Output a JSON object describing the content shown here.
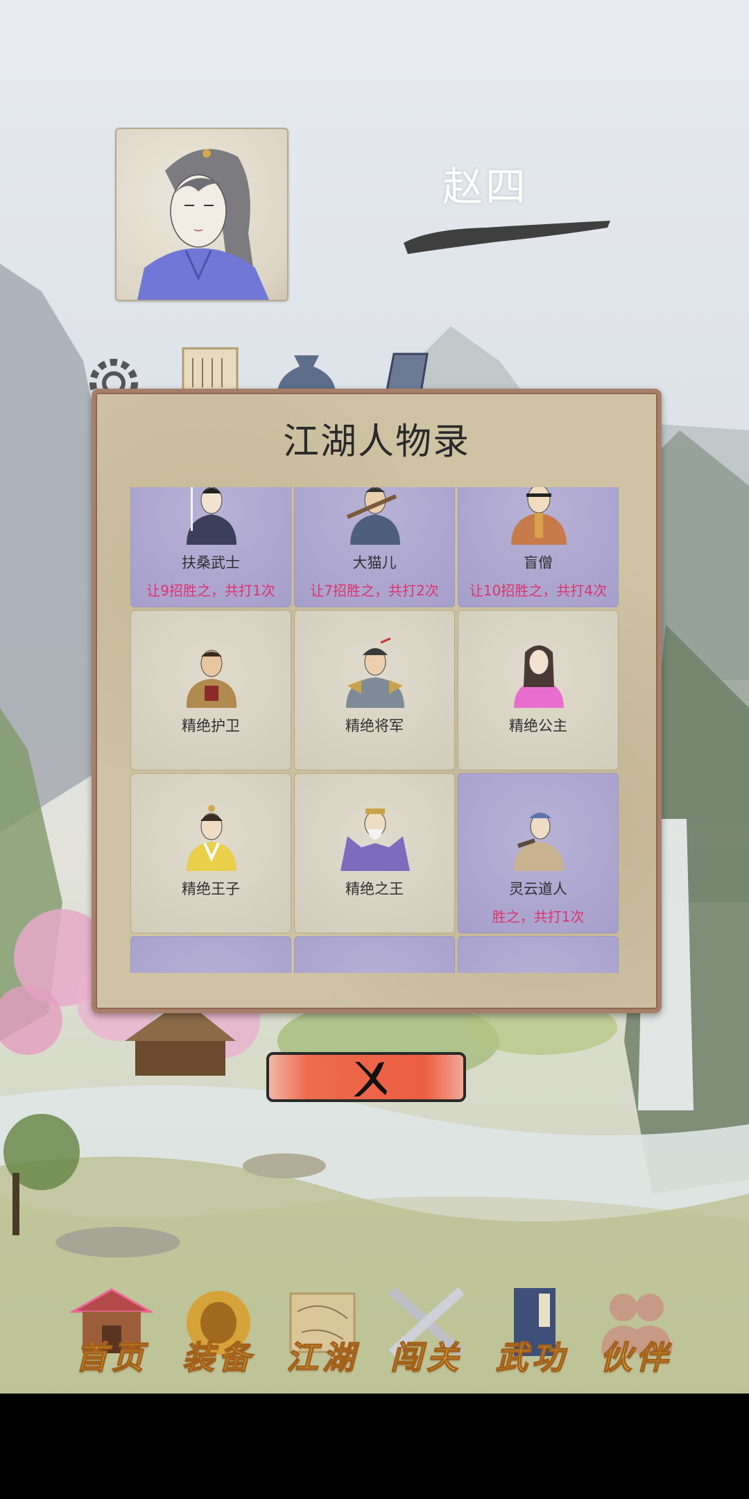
{
  "player": {
    "name": "赵四"
  },
  "modal": {
    "title": "江湖人物录",
    "characters": [
      {
        "name": "扶桑武士",
        "record": "让9招胜之，共打1次",
        "defeated": true,
        "icon": "samurai-portrait"
      },
      {
        "name": "大猫儿",
        "record": "让7招胜之，共打2次",
        "defeated": true,
        "icon": "bandit-portrait"
      },
      {
        "name": "盲僧",
        "record": "让10招胜之，共打4次",
        "defeated": true,
        "icon": "blind-monk-portrait"
      },
      {
        "name": "精绝护卫",
        "record": "",
        "defeated": false,
        "icon": "guard-portrait"
      },
      {
        "name": "精绝将军",
        "record": "",
        "defeated": false,
        "icon": "general-portrait"
      },
      {
        "name": "精绝公主",
        "record": "",
        "defeated": false,
        "icon": "princess-portrait"
      },
      {
        "name": "精绝王子",
        "record": "",
        "defeated": false,
        "icon": "prince-portrait"
      },
      {
        "name": "精绝之王",
        "record": "",
        "defeated": false,
        "icon": "king-portrait"
      },
      {
        "name": "灵云道人",
        "record": "胜之，共打1次",
        "defeated": true,
        "icon": "taoist-portrait"
      },
      {
        "name": "",
        "record": "",
        "defeated": true,
        "icon": "unknown-portrait"
      },
      {
        "name": "",
        "record": "",
        "defeated": true,
        "icon": "unknown-portrait"
      },
      {
        "name": "",
        "record": "",
        "defeated": true,
        "icon": "unknown-portrait"
      }
    ]
  },
  "close_button": {
    "icon": "close-x-icon",
    "color": "#ec5e42"
  },
  "top_icons": [
    "gear-icon",
    "scroll-icon",
    "money-bag-icon",
    "mirror-icon"
  ],
  "bottom_nav": [
    {
      "label": "首页",
      "icon": "house-icon"
    },
    {
      "label": "装备",
      "icon": "armor-icon"
    },
    {
      "label": "江湖",
      "icon": "map-scroll-icon"
    },
    {
      "label": "闯关",
      "icon": "crossed-swords-icon"
    },
    {
      "label": "武功",
      "icon": "martial-book-icon"
    },
    {
      "label": "伙伴",
      "icon": "companions-icon"
    }
  ],
  "colors": {
    "label_gold": "#f3c34a",
    "record_pink": "#e0326d",
    "defeated_card": "#a59fcb",
    "frame_brown": "#a77f68"
  }
}
